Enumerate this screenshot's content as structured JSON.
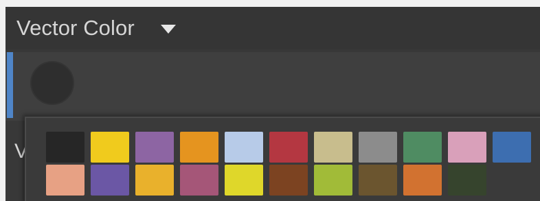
{
  "header": {
    "title": "Vector Color",
    "dropdown_icon": "caret-down-icon"
  },
  "under_row": {
    "label_visible_fragment": "V"
  },
  "swatches": {
    "row1": [
      "#262626",
      "#f0cb1d",
      "#8d65a3",
      "#e5941f",
      "#b7cbe8",
      "#b43741",
      "#c8bd8d",
      "#8c8c8c",
      "#4f8c62",
      "#d9a0ba",
      "#3d6eb0"
    ],
    "row2": [
      "#e7a184",
      "#6b57a5",
      "#e9b12c",
      "#a55678",
      "#dfd72a",
      "#7c4321",
      "#a1bb38",
      "#6b552f",
      "#d27230",
      "#36442d"
    ]
  },
  "colors": {
    "accent": "#4f85c8",
    "header_bg": "#353535",
    "panel_bg": "#383838"
  }
}
